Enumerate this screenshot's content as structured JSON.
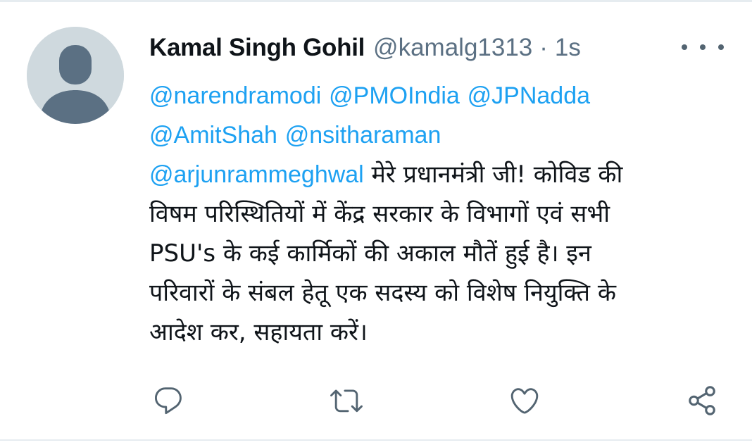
{
  "tweet": {
    "author_name": "Kamal Singh Gohil",
    "author_handle": "@kamalg1313",
    "separator": "·",
    "time": "1s",
    "mentions": [
      "@narendramodi",
      "@PMOIndia",
      "@JPNadda",
      "@AmitShah",
      "@nsitharaman",
      "@arjunrammeghwal"
    ],
    "text_lines": [
      " मेरे प्रधानमंत्री जी! कोविड की",
      "विषम परिस्थितियों में केंद्र सरकार के विभागों एवं सभी",
      "PSU's के कई कार्मिकों की अकाल मौतें हुई है। इन",
      "परिवारों के संबल हेतू एक सदस्य को विशेष नियुक्ति के",
      "आदेश कर, सहायता करें।"
    ]
  },
  "actions": [
    {
      "name": "reply",
      "icon": "reply-icon"
    },
    {
      "name": "retweet",
      "icon": "retweet-icon"
    },
    {
      "name": "like",
      "icon": "heart-icon"
    },
    {
      "name": "share",
      "icon": "share-icon"
    }
  ],
  "colors": {
    "link": "#1da1f2",
    "text": "#0f1419",
    "secondary": "#5b7083",
    "avatar_bg": "#cfd9de",
    "avatar_silhouette": "#5b7083"
  }
}
